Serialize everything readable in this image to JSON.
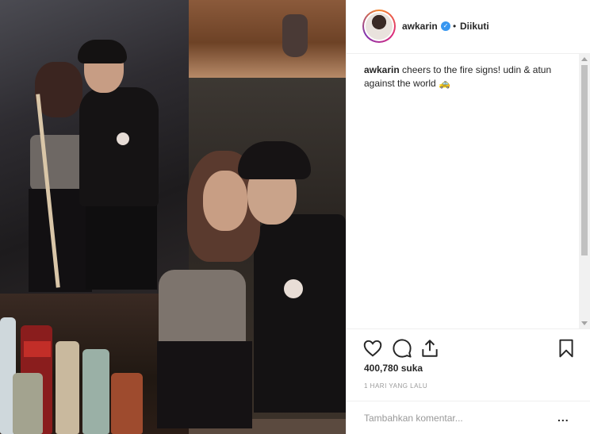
{
  "post": {
    "username": "awkarin",
    "verified_icon": "verified-badge-icon",
    "separator": "•",
    "follow_status": "Diikuti",
    "caption_user": "awkarin",
    "caption_text": "cheers to the fire signs! udin & atun against the world 🚕",
    "likes": "400,780 suka",
    "time": "1 HARI YANG LALU",
    "comment_placeholder": "Tambahkan komentar...",
    "more_label": "..."
  },
  "icons": [
    "heart-icon",
    "comment-icon",
    "share-icon",
    "bookmark-icon",
    "more-options-icon"
  ],
  "colors": {
    "verified": "#3897f0",
    "text": "#262626",
    "muted": "#999999",
    "border": "#efefef"
  }
}
